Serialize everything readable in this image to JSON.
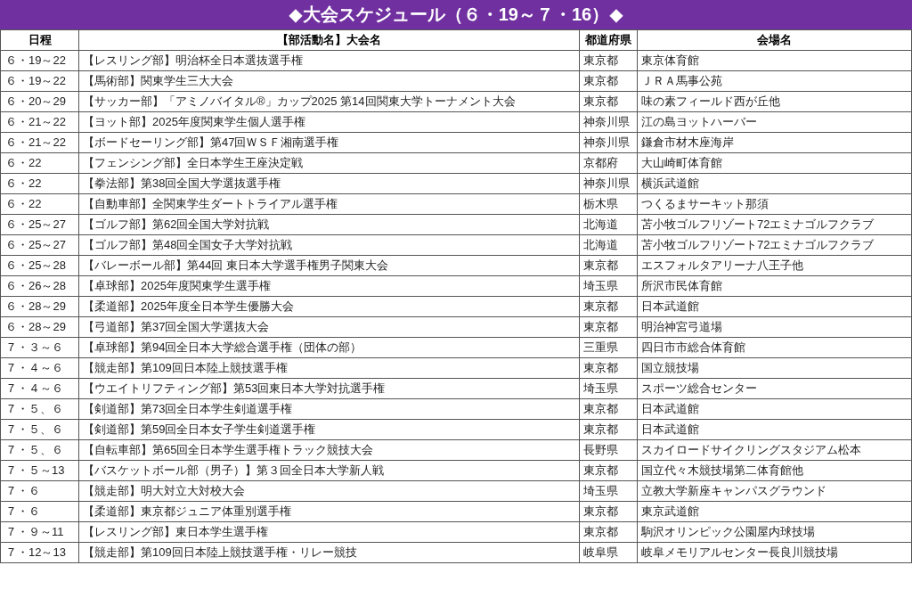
{
  "title": "◆大会スケジュール（６・19～７・16）◆",
  "table": {
    "columns": [
      "日程",
      "【部活動名】大会名",
      "都道府県",
      "会場名"
    ],
    "rows": [
      [
        "６・19～22",
        "【レスリング部】明治杯全日本選抜選手権",
        "東京都",
        "東京体育館"
      ],
      [
        "６・19～22",
        "【馬術部】関東学生三大大会",
        "東京都",
        "ＪＲＡ馬事公苑"
      ],
      [
        "６・20～29",
        "【サッカー部】「アミノバイタル®」カップ2025 第14回関東大学トーナメント大会",
        "東京都",
        "味の素フィールド西が丘他"
      ],
      [
        "６・21～22",
        "【ヨット部】2025年度関東学生個人選手権",
        "神奈川県",
        "江の島ヨットハーバー"
      ],
      [
        "６・21～22",
        "【ボードセーリング部】第47回ＷＳＦ湘南選手権",
        "神奈川県",
        "鎌倉市材木座海岸"
      ],
      [
        "６・22",
        "【フェンシング部】全日本学生王座決定戦",
        "京都府",
        "大山崎町体育館"
      ],
      [
        "６・22",
        "【拳法部】第38回全国大学選抜選手権",
        "神奈川県",
        "横浜武道館"
      ],
      [
        "６・22",
        "【自動車部】全関東学生ダートトライアル選手権",
        "栃木県",
        "つくるまサーキット那須"
      ],
      [
        "６・25～27",
        "【ゴルフ部】第62回全国大学対抗戦",
        "北海道",
        "苫小牧ゴルフリゾート72エミナゴルフクラブ"
      ],
      [
        "６・25～27",
        "【ゴルフ部】第48回全国女子大学対抗戦",
        "北海道",
        "苫小牧ゴルフリゾート72エミナゴルフクラブ"
      ],
      [
        "６・25～28",
        "【バレーボール部】第44回 東日本大学選手権男子関東大会",
        "東京都",
        "エスフォルタアリーナ八王子他"
      ],
      [
        "６・26～28",
        "【卓球部】2025年度関東学生選手権",
        "埼玉県",
        "所沢市民体育館"
      ],
      [
        "６・28～29",
        "【柔道部】2025年度全日本学生優勝大会",
        "東京都",
        "日本武道館"
      ],
      [
        "６・28～29",
        "【弓道部】第37回全国大学選抜大会",
        "東京都",
        "明治神宮弓道場"
      ],
      [
        "７・３～６",
        "【卓球部】第94回全日本大学総合選手権（団体の部）",
        "三重県",
        "四日市市総合体育館"
      ],
      [
        "７・４～６",
        "【競走部】第109回日本陸上競技選手権",
        "東京都",
        "国立競技場"
      ],
      [
        "７・４～６",
        "【ウエイトリフティング部】第53回東日本大学対抗選手権",
        "埼玉県",
        "スポーツ総合センター"
      ],
      [
        "７・５、６",
        "【剣道部】第73回全日本学生剣道選手権",
        "東京都",
        "日本武道館"
      ],
      [
        "７・５、６",
        "【剣道部】第59回全日本女子学生剣道選手権",
        "東京都",
        "日本武道館"
      ],
      [
        "７・５、６",
        "【自転車部】第65回全日本学生選手権トラック競技大会",
        "長野県",
        "スカイロードサイクリングスタジアム松本"
      ],
      [
        "７・５～13",
        "【バスケットボール部（男子）】第３回全日本大学新人戦",
        "東京都",
        "国立代々木競技場第二体育館他"
      ],
      [
        "７・６",
        "【競走部】明大対立大対校大会",
        "埼玉県",
        "立教大学新座キャンパスグラウンド"
      ],
      [
        "７・６",
        "【柔道部】東京都ジュニア体重別選手権",
        "東京都",
        "東京武道館"
      ],
      [
        "７・９～11",
        "【レスリング部】東日本学生選手権",
        "東京都",
        "駒沢オリンピック公園屋内球技場"
      ],
      [
        "７・12～13",
        "【競走部】第109回日本陸上競技選手権・リレー競技",
        "岐阜県",
        "岐阜メモリアルセンター長良川競技場"
      ]
    ]
  }
}
